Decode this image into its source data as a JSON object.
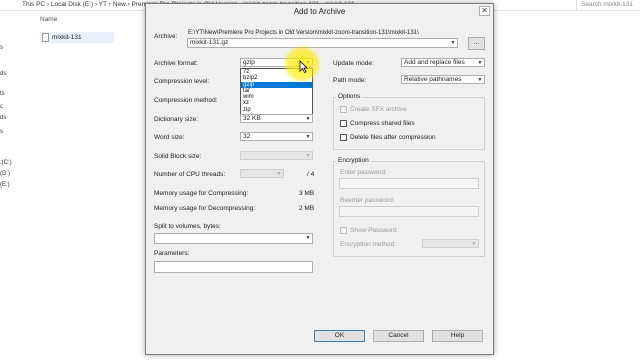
{
  "explorer": {
    "breadcrumb": "This PC  ›  Local Disk (E:)  ›  YT  ›  New  ›  Premiere Pro Projects in Old Version  ›  mixkit-zoom-transition-131  ›  mixkit-131",
    "search_placeholder": "Search mixkit-131",
    "column_name": "Name",
    "file_name": "mixkit-131",
    "nav_items": [
      "s",
      "ds",
      "ts",
      "c",
      "ds",
      "s",
      ":(C:)",
      "(D:)",
      "(E:)"
    ]
  },
  "dialog": {
    "title": "Add to Archive",
    "close": "✕",
    "archive_label": "Archive:",
    "archive_path": "E:\\YT\\New\\Premiere Pro Projects  in Old Version\\mixkit-zoom-transition-131\\mixkit-131\\",
    "archive_name": "mixkit-131.gz",
    "browse": "...",
    "archive_format_label": "Archive format:",
    "archive_format_value": "gzip",
    "format_options": [
      "7z",
      "bzip2",
      "gzip",
      "tar",
      "wim",
      "xz",
      "zip"
    ],
    "selected_format_index": 2,
    "compression_level_label": "Compression level:",
    "compression_method_label": "Compression method:",
    "dictionary_size_label": "Dictionary size:",
    "dictionary_size_value": "32 KB",
    "word_size_label": "Word size:",
    "word_size_value": "32",
    "solid_block_label": "Solid Block size:",
    "cpu_threads_label": "Number of CPU threads:",
    "cpu_threads_total": "/ 4",
    "mem_compress_label": "Memory usage for Compressing:",
    "mem_compress_value": "3 MB",
    "mem_decompress_label": "Memory usage for Decompressing:",
    "mem_decompress_value": "2 MB",
    "split_label": "Split to volumes, bytes:",
    "parameters_label": "Parameters:",
    "update_mode_label": "Update mode:",
    "update_mode_value": "Add and replace files",
    "path_mode_label": "Path mode:",
    "path_mode_value": "Relative pathnames",
    "options_title": "Options",
    "opt_sfx": "Create SFX archive",
    "opt_shared": "Compress shared files",
    "opt_delete": "Delete files after compression",
    "encryption_title": "Encryption",
    "enter_password": "Enter password:",
    "reenter_password": "Reenter password:",
    "show_password": "Show Password",
    "encryption_method": "Encryption method:",
    "ok": "OK",
    "cancel": "Cancel",
    "help": "Help"
  }
}
